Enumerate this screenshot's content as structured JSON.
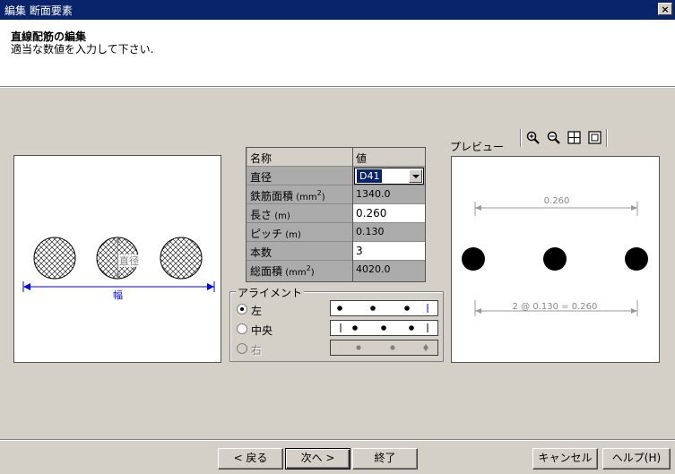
{
  "window": {
    "title": "編集 断面要素",
    "close_label": "×"
  },
  "header": {
    "title": "直線配筋の編集",
    "subtitle": "適当な数値を入力して下さい."
  },
  "diagram": {
    "diameter_label": "直径",
    "width_label": "幅"
  },
  "table": {
    "col_name": "名称",
    "col_value": "値",
    "rows": {
      "diameter": {
        "label": "直径",
        "value": "D41"
      },
      "area": {
        "label": "鉄筋面積",
        "unit_pre": "(mm",
        "unit_sup": "2",
        "unit_post": ")",
        "value": "1340.0"
      },
      "length": {
        "label": "長さ",
        "unit": "(m)",
        "value": "0.260"
      },
      "pitch": {
        "label": "ピッチ",
        "unit": "(m)",
        "value": "0.130"
      },
      "count": {
        "label": "本数",
        "value": "3"
      },
      "total_area": {
        "label": "総面積",
        "unit_pre": "(mm",
        "unit_sup": "2",
        "unit_post": ")",
        "value": "4020.0"
      }
    }
  },
  "alignment": {
    "legend": "アライメント",
    "options": [
      {
        "label": "左",
        "checked": true,
        "enabled": true
      },
      {
        "label": "中央",
        "checked": false,
        "enabled": true
      },
      {
        "label": "右",
        "checked": false,
        "enabled": false
      }
    ]
  },
  "preview": {
    "label": "プレビュー",
    "toolbar": [
      "zoom-in-icon",
      "zoom-out-icon",
      "zoom-all-icon",
      "zoom-window-icon"
    ],
    "dim_top": "0.260",
    "dim_bottom": "2 @ 0.130 = 0.260"
  },
  "buttons": {
    "back": "< 戻る",
    "next": "次へ >",
    "finish": "終了",
    "cancel": "キャンセル",
    "help": "ヘルプ(H)"
  }
}
